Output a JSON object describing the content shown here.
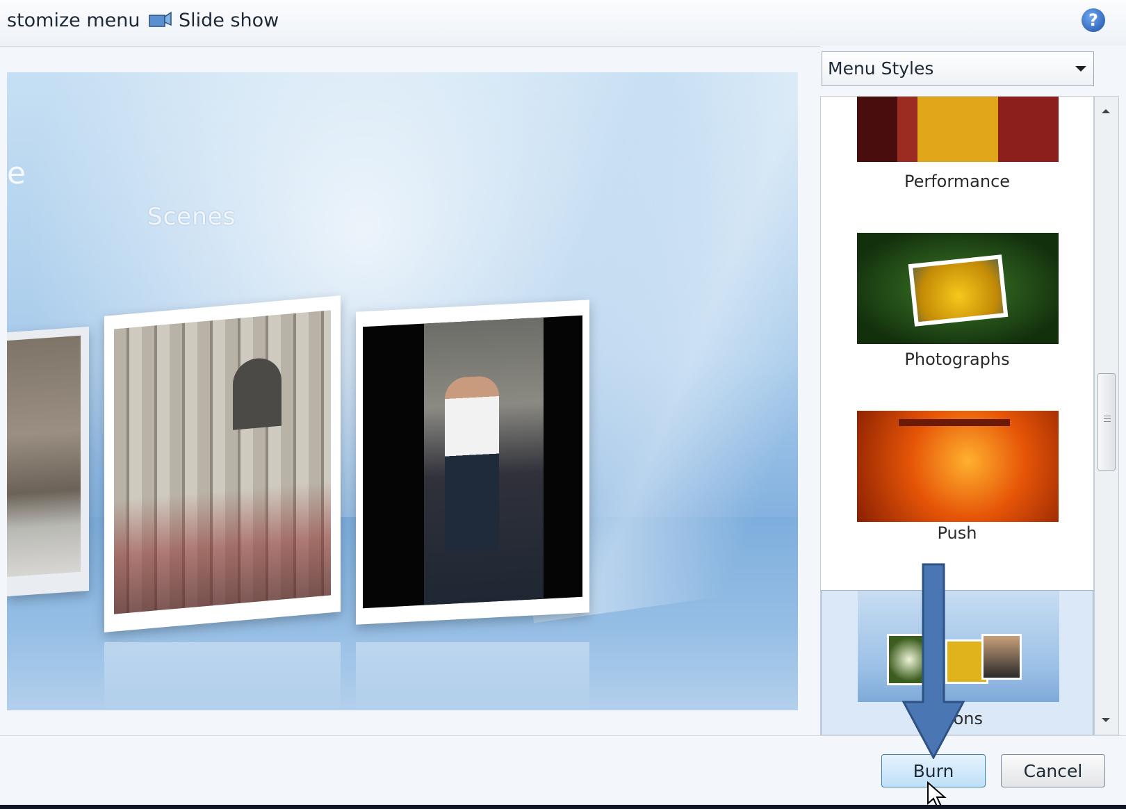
{
  "toolbar": {
    "customize_menu_label": "stomize menu",
    "slide_show_label": "Slide show",
    "help_icon": "?"
  },
  "preview": {
    "scenes_label": "Scenes",
    "partial_title_letter": "e"
  },
  "sidebar": {
    "style_select_value": "Menu Styles",
    "styles": [
      {
        "name": "Performance"
      },
      {
        "name": "Photographs"
      },
      {
        "name": "Push"
      },
      {
        "name": "Scenes",
        "selected": true,
        "visible_caption": "S        ions"
      }
    ]
  },
  "buttons": {
    "burn": "Burn",
    "cancel": "Cancel"
  },
  "annotation": {
    "arrow_color": "#4a76b3",
    "arrow_outline": "#2f5285"
  }
}
